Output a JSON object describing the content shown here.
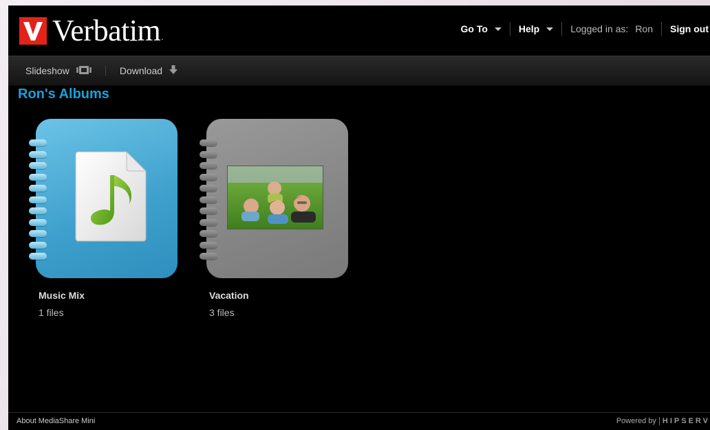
{
  "header": {
    "logo_mark": "V",
    "logo_text": "Verbatim",
    "logo_suffix": ".",
    "nav": {
      "goto_label": "Go To",
      "help_label": "Help",
      "logged_in_label": "Logged in as:",
      "user_name": "Ron",
      "signout_label": "Sign out"
    }
  },
  "toolbar": {
    "slideshow_label": "Slideshow",
    "download_label": "Download"
  },
  "main": {
    "title": "Ron's Albums",
    "albums": [
      {
        "name": "Music Mix",
        "count": "1 files",
        "cover_color": "#4aa8d2",
        "icon": "music-document-icon"
      },
      {
        "name": "Vacation",
        "count": "3 files",
        "cover_color": "#8a8a8a",
        "icon": "family-photo"
      }
    ]
  },
  "footer": {
    "about_label": "About MediaShare Mini",
    "powered_label": "Powered by",
    "powered_brand": "HIPSERV"
  },
  "colors": {
    "accent": "#1aa0da",
    "logo_red": "#e2231a",
    "background": "#000000"
  }
}
